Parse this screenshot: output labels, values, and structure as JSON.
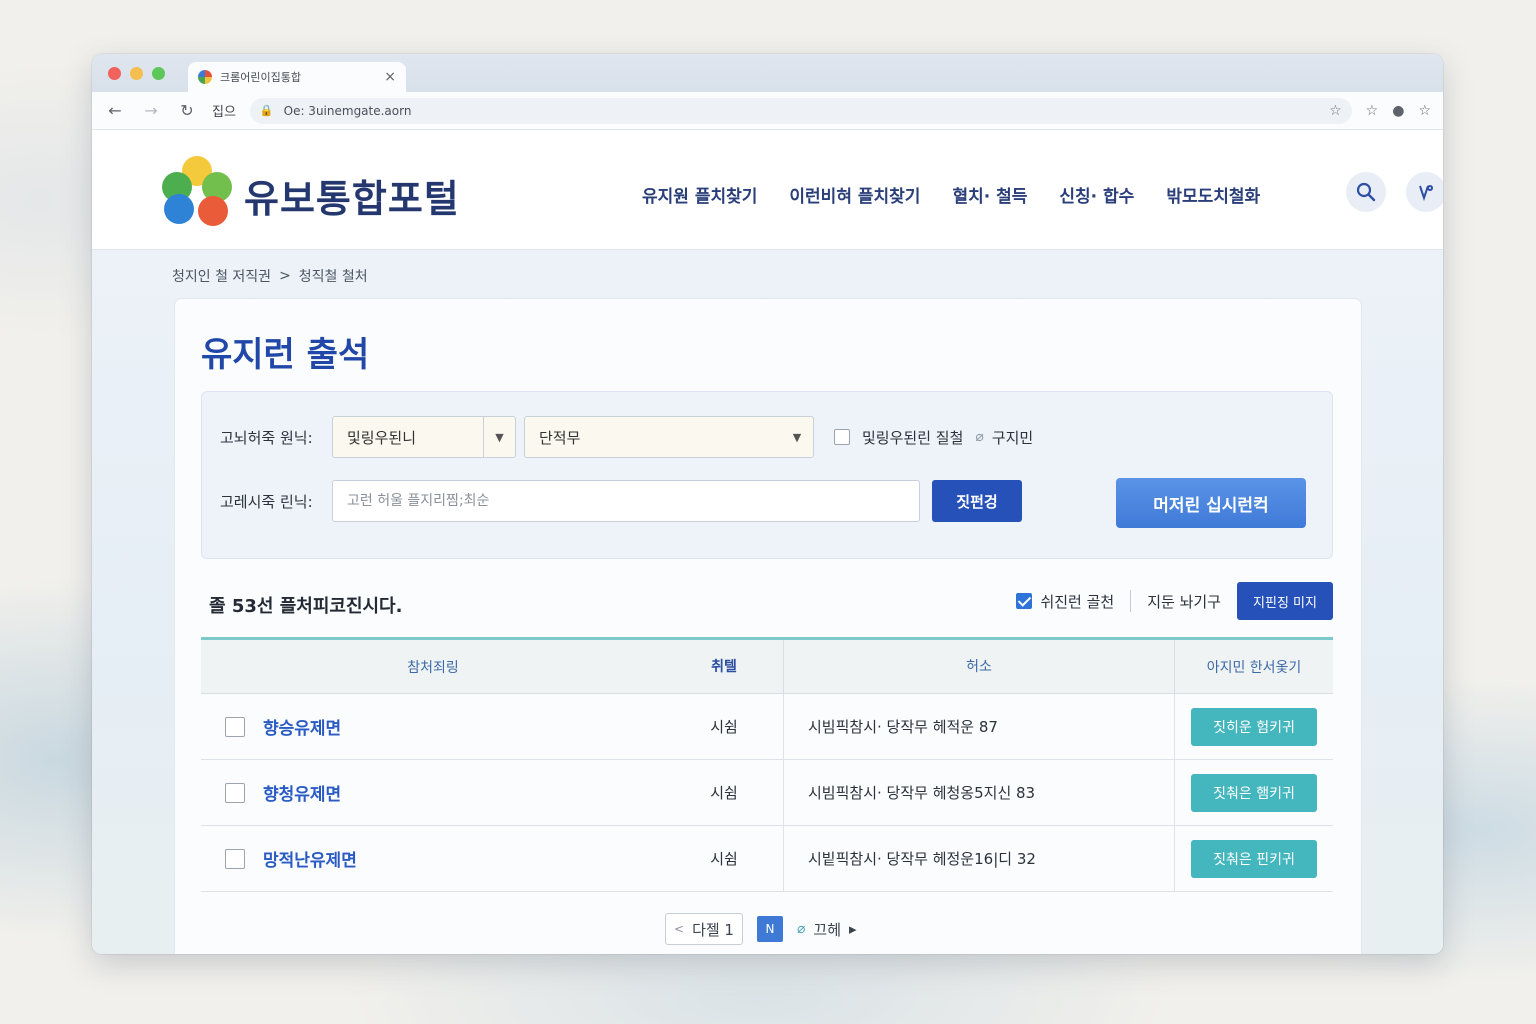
{
  "browser": {
    "tab_title": "크롬어린이집통합",
    "tab_close": "×",
    "home_label": "집으",
    "url": "Oe: 3uinemgate.aorn",
    "icons": [
      "back-icon",
      "forward-icon",
      "reload-icon",
      "lock-icon",
      "star-icon",
      "bookmark-icon",
      "profile-icon",
      "extension-icon"
    ]
  },
  "site": {
    "logo_text": "유보통합포털",
    "nav": [
      "유지원 플치찾기",
      "이런비혀 플치찾기",
      "혈치· 철득",
      "신칭· 합수",
      "밖모도치철화"
    ],
    "colors": {
      "brand": "#2148a8",
      "teal": "#43b6be",
      "button": "#2651b8"
    }
  },
  "breadcrumb": {
    "first": "청지인 철 저직권",
    "sep": ">",
    "second": "청직철 철처"
  },
  "main": {
    "page_title": "유지런 출석",
    "filters": {
      "region_label": "고뇌허죽 원닉:",
      "region_value": "및링우된니",
      "district_value": "단적무",
      "check_label": "및링우된린 질철",
      "extra_label": "구지민",
      "keyword_label": "고레시죽 린닉:",
      "keyword_placeholder": "고런 허울 플지리찜;최순",
      "search_button": "짓펀겅",
      "big_button": "머저린 십시런컥"
    },
    "results": {
      "count_text": "졸 53선 플처피코진시다.",
      "option_label": "쉬진런 골천",
      "sort_label": "지둔 놔기구",
      "map_button": "지핀징 미지"
    },
    "table": {
      "headers": {
        "name": "참처죄링",
        "type": "취텔",
        "address": "허소",
        "action": "아지민 한서옻기"
      },
      "rows": [
        {
          "name": "향승유제면",
          "type": "시쉼",
          "address": "시빔픽참시· 당작무 헤적운 87",
          "action": "짓히운 험키귀"
        },
        {
          "name": "향청유제면",
          "type": "시쉼",
          "address": "시빔픽참시· 당작무 헤청옹5지신 83",
          "action": "짓춰은 햄키귀"
        },
        {
          "name": "망적난유제면",
          "type": "시쉼",
          "address": "시빝픽참시· 당작무 헤정운16|디 32",
          "action": "짓춰은 핀키귀"
        }
      ]
    },
    "pager": {
      "prev": "다젤 1",
      "current": "N",
      "next": "끄헤"
    }
  }
}
